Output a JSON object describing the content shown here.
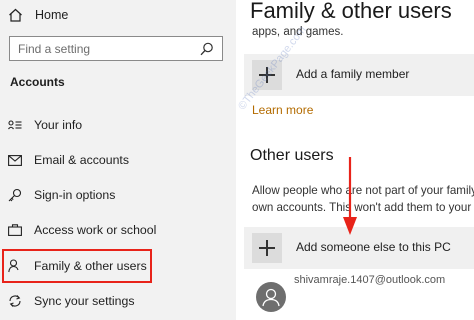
{
  "sidebar": {
    "home": {
      "label": "Home",
      "icon": "home-icon"
    },
    "search": {
      "placeholder": "Find a setting",
      "icon": "search-icon"
    },
    "section_title": "Accounts",
    "items": [
      {
        "label": "Your info",
        "icon": "your-info-icon"
      },
      {
        "label": "Email & accounts",
        "icon": "mail-icon"
      },
      {
        "label": "Sign-in options",
        "icon": "key-icon"
      },
      {
        "label": "Access work or school",
        "icon": "briefcase-icon"
      },
      {
        "label": "Family & other users",
        "icon": "person-icon",
        "selected": true
      },
      {
        "label": "Sync your settings",
        "icon": "sync-icon"
      }
    ]
  },
  "main": {
    "title": "Family & other users",
    "partial_text": "apps, and games.",
    "add_family_member": "Add a family member",
    "learn_more": "Learn more",
    "other_users_heading": "Other users",
    "description_lines": [
      "Allow people who are not part of your family t",
      "own accounts. This won't add them to your"
    ],
    "add_someone": "Add someone else to this PC",
    "user_email": "shivamraje.1407@outlook.com"
  },
  "watermark": "©TheGeekPage.com",
  "colors": {
    "highlight_box": "#e8231a",
    "arrow": "#e8231a",
    "link": "#b36b00"
  }
}
